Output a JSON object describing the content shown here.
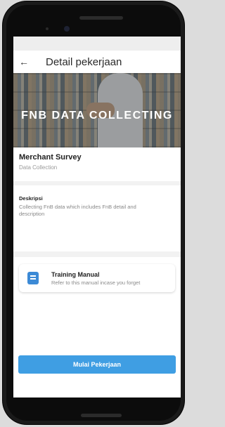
{
  "appbar": {
    "back_icon": "arrow-left-icon",
    "title": "Detail pekerjaan"
  },
  "banner": {
    "text": "FNB DATA COLLECTING"
  },
  "merchant": {
    "name": "Merchant Survey",
    "category": "Data Collection"
  },
  "description": {
    "heading": "Deskripsi",
    "body": "Collecting FnB data which includes FnB detail and description"
  },
  "manual": {
    "icon": "book-icon",
    "title": "Training Manual",
    "subtitle": "Refer to this manual incase you forget"
  },
  "footer": {
    "cta_label": "Mulai Pekerjaan"
  },
  "colors": {
    "primary": "#3f9ee3",
    "background": "#f2f2f2"
  }
}
